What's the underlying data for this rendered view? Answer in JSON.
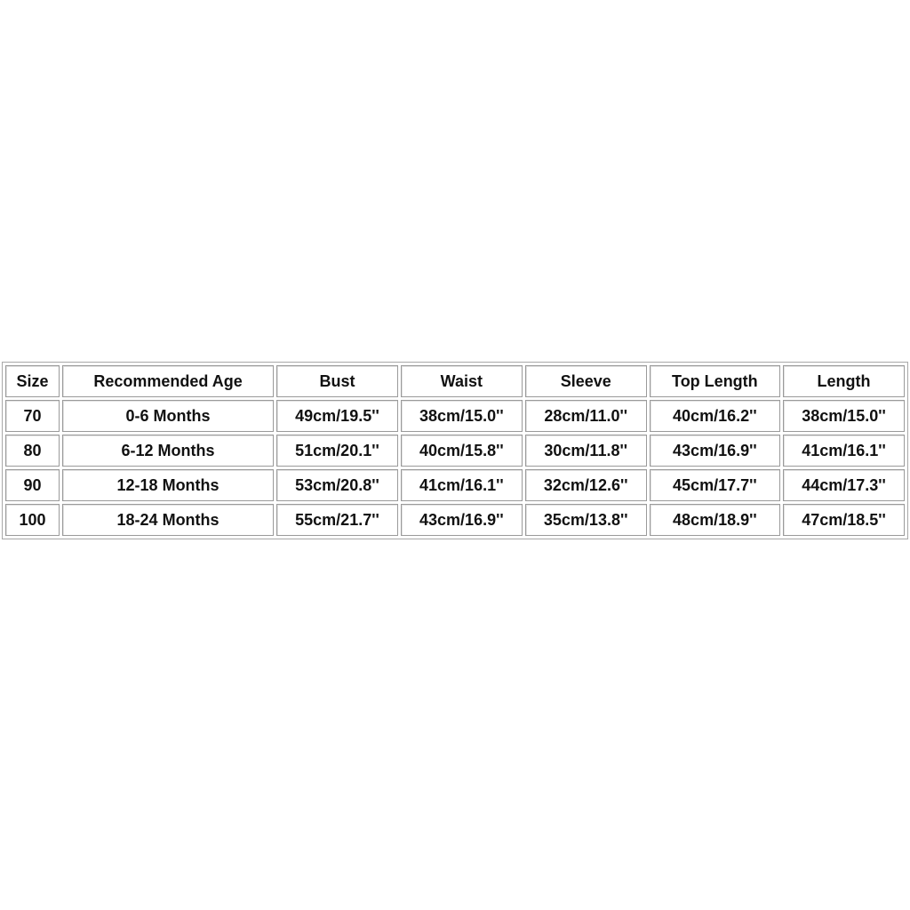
{
  "size_chart": {
    "headers": [
      "Size",
      "Recommended Age",
      "Bust",
      "Waist",
      "Sleeve",
      "Top Length",
      "Length"
    ],
    "rows": [
      [
        "70",
        "0-6 Months",
        "49cm/19.5''",
        "38cm/15.0''",
        "28cm/11.0''",
        "40cm/16.2''",
        "38cm/15.0''"
      ],
      [
        "80",
        "6-12 Months",
        "51cm/20.1''",
        "40cm/15.8''",
        "30cm/11.8''",
        "43cm/16.9''",
        "41cm/16.1''"
      ],
      [
        "90",
        "12-18 Months",
        "53cm/20.8''",
        "41cm/16.1''",
        "32cm/12.6''",
        "45cm/17.7''",
        "44cm/17.3''"
      ],
      [
        "100",
        "18-24 Months",
        "55cm/21.7''",
        "43cm/16.9''",
        "35cm/13.8''",
        "48cm/18.9''",
        "47cm/18.5''"
      ]
    ]
  }
}
